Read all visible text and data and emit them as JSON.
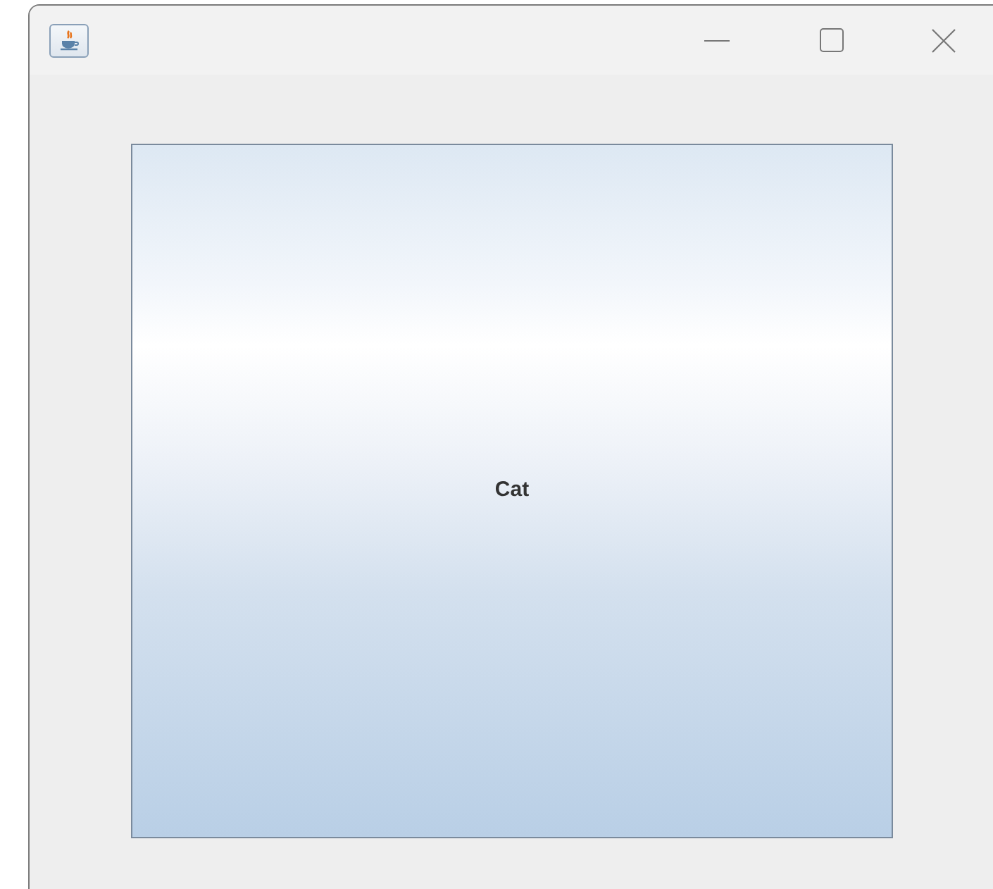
{
  "button": {
    "label": "Cat"
  }
}
